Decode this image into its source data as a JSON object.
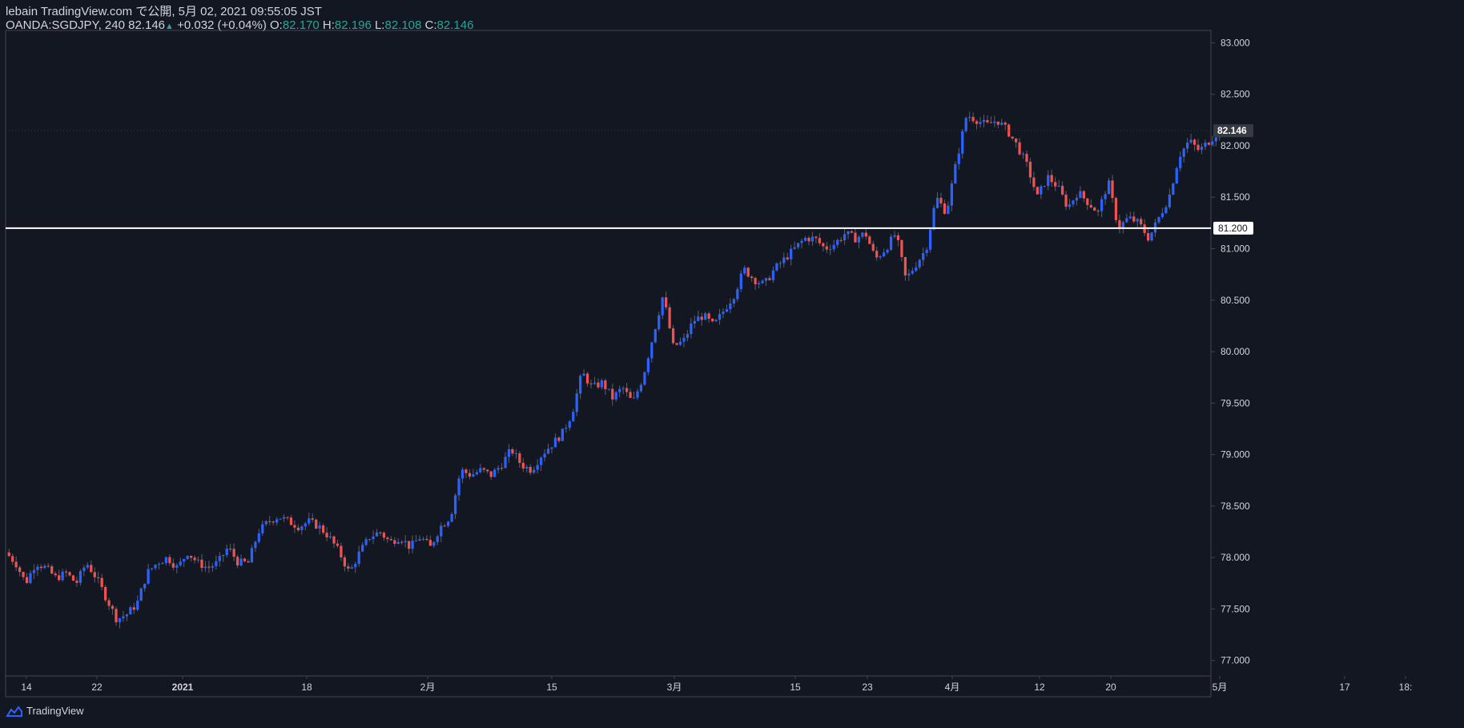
{
  "header": {
    "line1": "lebain TradingView.com で公開, 5月 02, 2021 09:55:05 JST",
    "symbol": "OANDA:SGDJPY, 240",
    "last": "82.146",
    "change": "+0.032 (+0.04%)",
    "o_label": "O:",
    "o_value": "82.170",
    "h_label": "H:",
    "h_value": "82.196",
    "l_label": "L:",
    "l_value": "82.108",
    "c_label": "C:",
    "c_value": "82.146"
  },
  "footer": {
    "brand": "TradingView"
  },
  "colors": {
    "background": "#131722",
    "up": "#2962ff",
    "down": "#ef5350",
    "axis_text": "#d1d4dc",
    "border": "#434651",
    "hline": "#ffffff"
  },
  "chart_data": {
    "type": "candlestick",
    "y_ticks": [
      "83.000",
      "82.500",
      "82.000",
      "81.500",
      "81.000",
      "80.500",
      "80.000",
      "79.500",
      "79.000",
      "78.500",
      "78.000",
      "77.500",
      "77.000"
    ],
    "ylim": [
      76.85,
      83.12
    ],
    "x_ticks": [
      "14",
      "22",
      "2021",
      "18",
      "2月",
      "15",
      "3月",
      "15",
      "23",
      "4月",
      "12",
      "20",
      "5月",
      "17",
      "18:"
    ],
    "current_price_label": "82.146",
    "current_price": 82.146,
    "hline_label": "81.200",
    "hline_value": 81.2,
    "close_path": [
      78.05,
      77.95,
      77.75,
      77.95,
      77.9,
      77.8,
      77.85,
      77.75,
      77.95,
      77.8,
      77.6,
      77.4,
      77.45,
      77.55,
      77.85,
      77.95,
      78.0,
      77.9,
      78.05,
      77.95,
      77.9,
      77.95,
      78.1,
      77.95,
      77.95,
      78.25,
      78.35,
      78.4,
      78.35,
      78.3,
      78.35,
      78.3,
      78.2,
      78.05,
      77.85,
      78.05,
      78.2,
      78.25,
      78.15,
      78.2,
      78.1,
      78.2,
      78.1,
      78.3,
      78.4,
      78.85,
      78.8,
      78.85,
      78.8,
      78.9,
      79.05,
      78.9,
      78.85,
      79.0,
      79.1,
      79.2,
      79.4,
      79.8,
      79.65,
      79.7,
      79.55,
      79.65,
      79.5,
      79.75,
      80.15,
      80.55,
      80.05,
      80.1,
      80.3,
      80.35,
      80.25,
      80.4,
      80.55,
      80.8,
      80.7,
      80.65,
      80.8,
      80.9,
      81.0,
      81.1,
      81.1,
      81.0,
      81.05,
      81.15,
      81.1,
      81.15,
      80.9,
      81.0,
      81.15,
      80.7,
      80.85,
      81.0,
      81.5,
      81.35,
      81.85,
      82.3,
      82.25,
      82.2,
      82.25,
      82.15,
      82.0,
      81.8,
      81.5,
      81.7,
      81.6,
      81.4,
      81.55,
      81.45,
      81.35,
      81.65,
      81.2,
      81.3,
      81.25,
      81.1,
      81.3,
      81.5,
      81.9,
      82.05,
      81.95,
      82.05,
      82.146
    ]
  }
}
